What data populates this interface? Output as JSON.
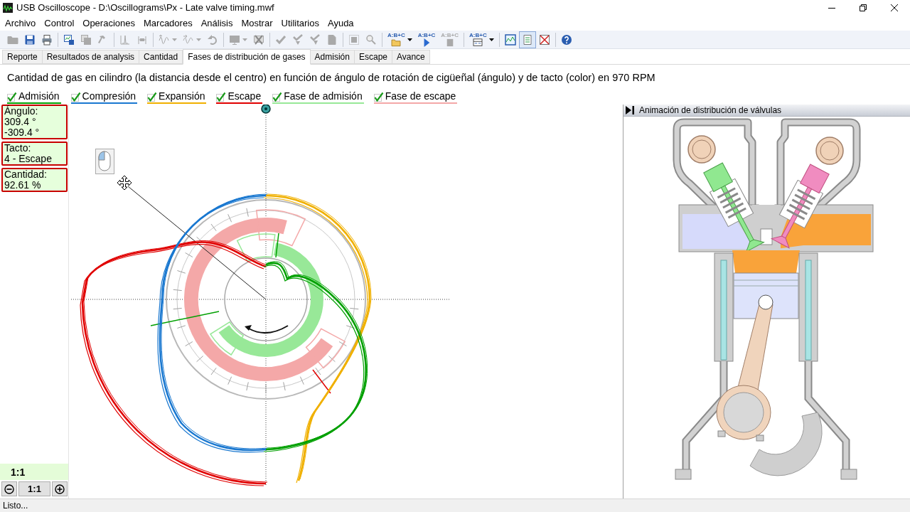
{
  "window": {
    "title": "USB Oscilloscope - D:\\Oscillograms\\Px - Late valve timing.mwf"
  },
  "menu": [
    "Archivo",
    "Control",
    "Operaciones",
    "Marcadores",
    "Análisis",
    "Mostrar",
    "Utilitarios",
    "Ayuda"
  ],
  "toolbar_groups": [
    [
      {
        "kind": "open",
        "disabled": true,
        "pressed": false
      },
      {
        "kind": "save",
        "disabled": false,
        "pressed": false
      },
      {
        "kind": "print",
        "disabled": false,
        "pressed": false
      }
    ],
    [
      {
        "kind": "export",
        "disabled": false,
        "pressed": false
      },
      {
        "kind": "copy",
        "disabled": true,
        "pressed": false
      },
      {
        "kind": "hammer",
        "disabled": true,
        "pressed": false
      }
    ],
    [
      {
        "kind": "peak",
        "disabled": true,
        "pressed": false
      },
      {
        "kind": "cursor",
        "disabled": true,
        "pressed": false
      }
    ],
    [
      {
        "kind": "wave",
        "disabled": true,
        "pressed": false,
        "dropdown": true
      },
      {
        "kind": "wave2",
        "disabled": true,
        "pressed": false,
        "dropdown": true
      },
      {
        "kind": "undo",
        "disabled": true,
        "pressed": false
      }
    ],
    [
      {
        "kind": "monitor",
        "disabled": true,
        "pressed": false,
        "dropdown": true
      },
      {
        "kind": "unmonitor",
        "disabled": true,
        "pressed": false
      }
    ],
    [
      {
        "kind": "check",
        "disabled": true,
        "pressed": false
      },
      {
        "kind": "accept",
        "disabled": true,
        "pressed": false
      },
      {
        "kind": "accept2",
        "disabled": true,
        "pressed": false
      },
      {
        "kind": "page",
        "disabled": true,
        "pressed": false
      }
    ],
    [
      {
        "kind": "grid",
        "disabled": true,
        "pressed": false
      },
      {
        "kind": "zoom",
        "disabled": true,
        "pressed": false
      }
    ],
    [
      {
        "kind": "load",
        "caption": "A:B+C",
        "disabled": false,
        "pressed": false,
        "dropdown": true
      },
      {
        "kind": "play",
        "caption": "A:B+C",
        "disabled": false,
        "pressed": false
      },
      {
        "kind": "stop",
        "caption": "A:B+C",
        "disabled": true,
        "pressed": false
      }
    ],
    [
      {
        "kind": "panel",
        "caption": "A:B+C",
        "disabled": false,
        "pressed": false,
        "dropdown": true
      }
    ],
    [
      {
        "kind": "chart",
        "disabled": false,
        "pressed": false
      },
      {
        "kind": "sheet",
        "disabled": false,
        "pressed": true
      },
      {
        "kind": "clear",
        "disabled": false,
        "pressed": false
      }
    ],
    [
      {
        "kind": "help",
        "disabled": false,
        "pressed": false
      }
    ]
  ],
  "tabs": [
    {
      "label": "Reporte",
      "selected": false
    },
    {
      "label": "Resultados de analysis",
      "selected": false
    },
    {
      "label": "Cantidad",
      "selected": false
    },
    {
      "label": "Fases de distribución de gases",
      "selected": true
    },
    {
      "label": "Admisión",
      "selected": false
    },
    {
      "label": "Escape",
      "selected": false
    },
    {
      "label": "Avance",
      "selected": false
    }
  ],
  "description": "Cantidad de gas en cilindro (la distancia desde el centro) en función de ángulo de rotación de cigüeñal (ángulo) y de tacto (color) en 970 RPM",
  "legend": [
    {
      "label": "Admisión",
      "checked": true,
      "color": "#00a000"
    },
    {
      "label": "Compresión",
      "checked": true,
      "color": "#1a78d0"
    },
    {
      "label": "Expansión",
      "checked": true,
      "color": "#f0b000"
    },
    {
      "label": "Escape",
      "checked": true,
      "color": "#e00000"
    },
    {
      "label": "Fase de admisión",
      "checked": true,
      "color": "#98e898"
    },
    {
      "label": "Fase de escape",
      "checked": true,
      "color": "#f4a8a8"
    }
  ],
  "readouts": [
    {
      "label": "Ángulo:",
      "values": [
        "309.4 °",
        "-309.4 °"
      ]
    },
    {
      "label": "Tacto:",
      "values": [
        "4 - Escape"
      ]
    },
    {
      "label": "Cantidad:",
      "values": [
        "92.61 %"
      ]
    }
  ],
  "zoom": {
    "scale": "1:1",
    "reset_button": "1:1"
  },
  "animation_panel": {
    "title": "Animación de distribución de válvulas"
  },
  "status_bar": "Listo..."
}
